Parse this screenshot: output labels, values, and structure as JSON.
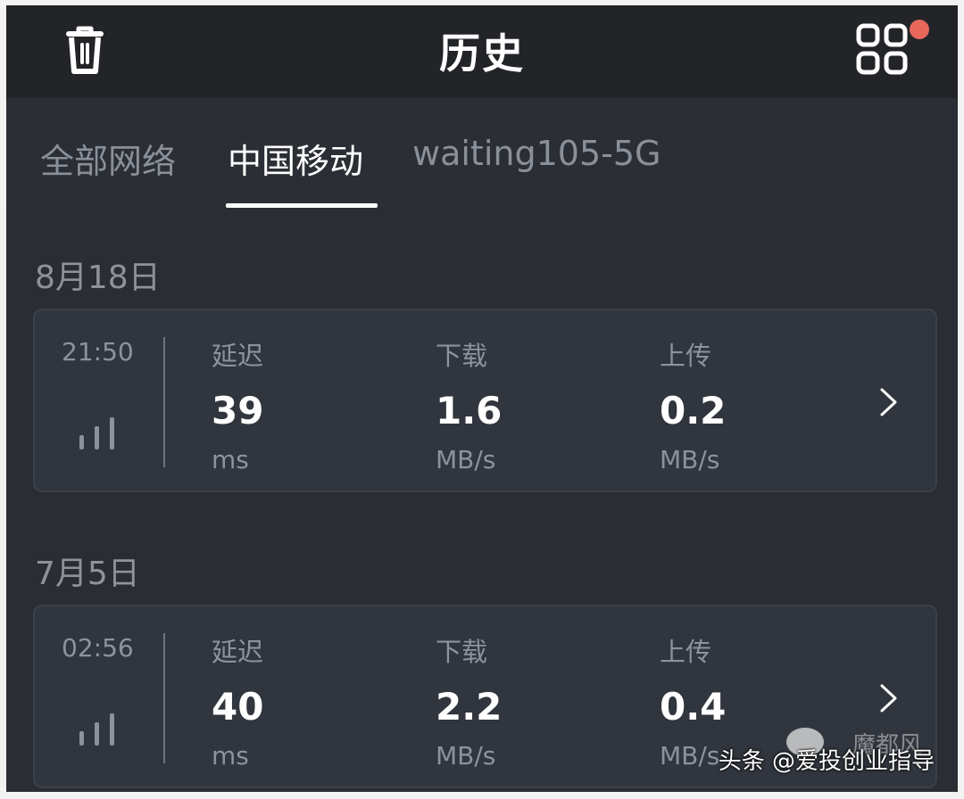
{
  "header": {
    "title": "历史",
    "left_icon": "trash-icon",
    "right_icon": "grid-apps-icon",
    "notification_dot_color": "#e8695c"
  },
  "tabs": [
    {
      "label": "全部网络",
      "active": false
    },
    {
      "label": "中国移动",
      "active": true
    },
    {
      "label": "waiting105-5G",
      "active": false
    }
  ],
  "sections": [
    {
      "date": "8月18日",
      "record": {
        "time": "21:50",
        "latency_label": "延迟",
        "latency_value": "39",
        "latency_unit": "ms",
        "download_label": "下载",
        "download_value": "1.6",
        "download_unit": "MB/s",
        "upload_label": "上传",
        "upload_value": "0.2",
        "upload_unit": "MB/s",
        "signal_icon": "signal-bars-icon",
        "chevron_icon": "chevron-right-icon"
      }
    },
    {
      "date": "7月5日",
      "record": {
        "time": "02:56",
        "latency_label": "延迟",
        "latency_value": "40",
        "latency_unit": "ms",
        "download_label": "下载",
        "download_value": "2.2",
        "download_unit": "MB/s",
        "upload_label": "上传",
        "upload_value": "0.4",
        "upload_unit": "MB/s",
        "signal_icon": "signal-bars-icon",
        "chevron_icon": "chevron-right-icon"
      }
    }
  ],
  "watermark": {
    "text": "头条 @爱投创业指导",
    "faded_text": "魔都风"
  },
  "colors": {
    "background": "#2a2d33",
    "header": "#222428",
    "card": "#31353d",
    "text_primary": "#ffffff",
    "text_secondary": "#8e939b"
  }
}
